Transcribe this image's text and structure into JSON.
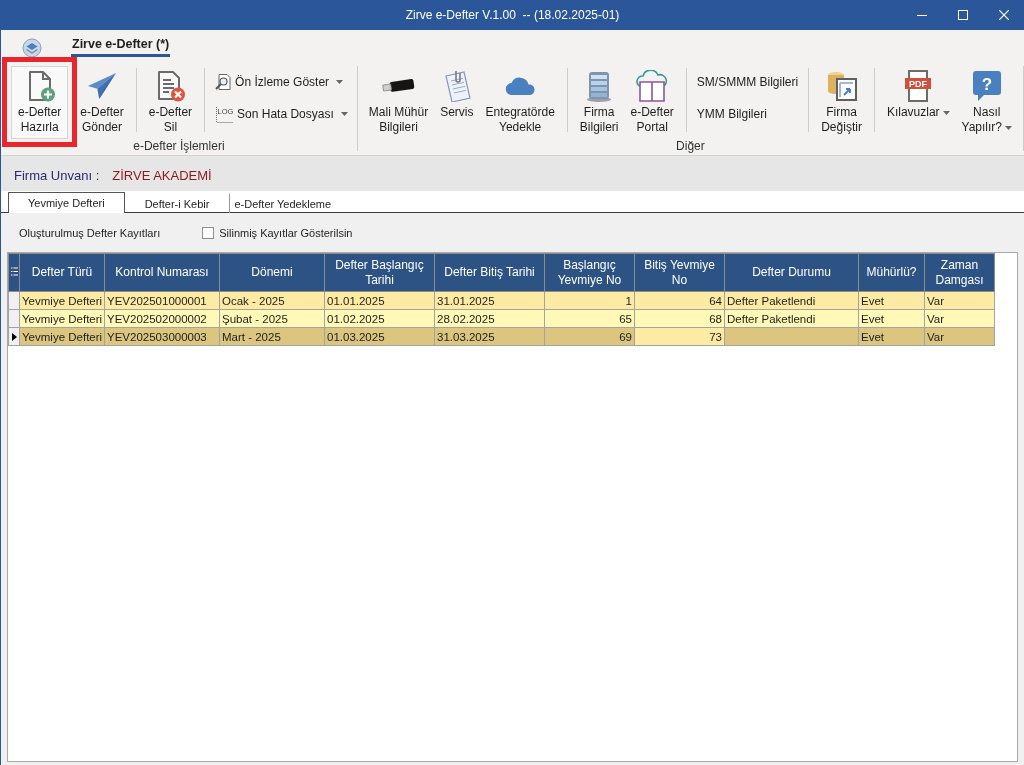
{
  "window": {
    "title": "Zirve e-Defter V.1.00  -- (18.02.2025-01)"
  },
  "ribbon_tabs": [
    {
      "label": "Zirve e-Defter (*)",
      "selected": true
    }
  ],
  "ribbon_groups": [
    {
      "label": "e-Defter İşlemleri",
      "sections": [
        {
          "items": [
            {
              "kind": "large",
              "label": "e-Defter\nHazırla",
              "dropdown": false,
              "highlighted": true
            },
            {
              "kind": "large",
              "label": "e-Defter\nGönder",
              "dropdown": false,
              "highlighted": false
            }
          ]
        },
        {
          "items": [
            {
              "kind": "large",
              "label": "e-Defter\nSil",
              "dropdown": false,
              "highlighted": false
            }
          ]
        },
        {
          "items": [
            {
              "kind": "small",
              "label": "Ön İzleme Göster",
              "dropdown": true,
              "highlighted": false
            },
            {
              "kind": "small",
              "label": "Son Hata Dosyası",
              "dropdown": true,
              "highlighted": false,
              "icon_text": "LOG"
            }
          ]
        }
      ]
    },
    {
      "label": "Diğer",
      "sections": [
        {
          "items": [
            {
              "kind": "large",
              "label": "Mali Mühür\nBilgileri",
              "dropdown": false,
              "highlighted": false
            },
            {
              "kind": "large",
              "label": "Servis",
              "dropdown": false,
              "highlighted": false
            },
            {
              "kind": "large",
              "label": "Entegratörde\nYedekle",
              "dropdown": false,
              "highlighted": false
            }
          ]
        },
        {
          "items": [
            {
              "kind": "large",
              "label": "Firma\nBilgileri",
              "dropdown": false,
              "highlighted": false
            },
            {
              "kind": "large",
              "label": "e-Defter\nPortal",
              "dropdown": false,
              "highlighted": false
            }
          ]
        },
        {
          "items": [
            {
              "kind": "text",
              "label": "SM/SMMM Bilgileri",
              "dropdown": false,
              "highlighted": false
            },
            {
              "kind": "text",
              "label": "YMM Bilgileri",
              "dropdown": false,
              "highlighted": false
            }
          ]
        },
        {
          "items": [
            {
              "kind": "large",
              "label": "Firma\nDeğiştir",
              "dropdown": false,
              "highlighted": false
            }
          ]
        },
        {
          "items": [
            {
              "kind": "large",
              "label": "Kılavuzlar",
              "dropdown": true,
              "highlighted": false,
              "icon_text": "PDF"
            },
            {
              "kind": "large",
              "label": "Nasıl\nYapılır?",
              "dropdown": true,
              "highlighted": false,
              "icon_text": "?"
            }
          ]
        }
      ]
    }
  ],
  "company": {
    "label": "Firma Unvanı :",
    "value": "ZİRVE AKADEMİ"
  },
  "tabs": [
    {
      "label": "Yevmiye Defteri",
      "selected": true
    },
    {
      "label": "Defter-i Kebir",
      "selected": false
    },
    {
      "label": "e-Defter Yedekleme",
      "selected": false
    }
  ],
  "records": {
    "title": "Oluşturulmuş Defter Kayıtları",
    "show_deleted": {
      "label": "Silinmiş Kayıtlar Gösterilsin",
      "checked": false
    }
  },
  "table": {
    "columns": [
      {
        "label": "Defter Türü",
        "kind": "text",
        "focused": false
      },
      {
        "label": "Kontrol Numarası",
        "kind": "text",
        "focused": false
      },
      {
        "label": "Dönemi",
        "kind": "text",
        "focused": false
      },
      {
        "label": "Defter Başlangıç Tarihi",
        "kind": "text",
        "focused": false
      },
      {
        "label": "Defter Bitiş Tarihi",
        "kind": "text",
        "focused": false
      },
      {
        "label": "Başlangıç Yevmiye No",
        "kind": "number",
        "focused": false
      },
      {
        "label": "Bitiş Yevmiye No",
        "kind": "number",
        "focused": true
      },
      {
        "label": "Defter Durumu",
        "kind": "text",
        "focused": false
      },
      {
        "label": "Mühürlü?",
        "kind": "text",
        "focused": false
      },
      {
        "label": "Zaman Damgası",
        "kind": "text",
        "focused": false
      }
    ],
    "rows": [
      {
        "selected": false,
        "cells": [
          "Yevmiye Defteri",
          "YEV202501000001",
          "Ocak - 2025",
          "01.01.2025",
          "31.01.2025",
          "1",
          "64",
          "Defter Paketlendi",
          "Evet",
          "Var"
        ]
      },
      {
        "selected": false,
        "cells": [
          "Yevmiye Defteri",
          "YEV202502000002",
          "Şubat - 2025",
          "01.02.2025",
          "28.02.2025",
          "65",
          "68",
          "Defter Paketlendi",
          "Evet",
          "Var"
        ]
      },
      {
        "selected": true,
        "cells": [
          "Yevmiye Defteri",
          "YEV202503000003",
          "Mart - 2025",
          "01.03.2025",
          "31.03.2025",
          "69",
          "73",
          null,
          "Evet",
          "Var"
        ]
      }
    ]
  }
}
